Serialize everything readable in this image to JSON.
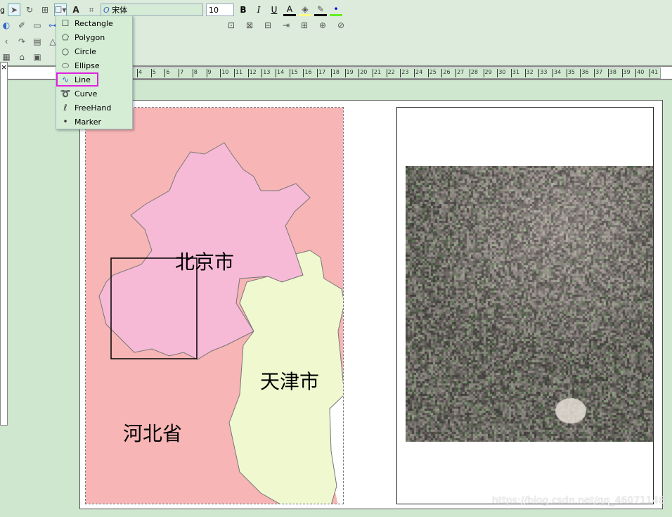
{
  "toolbar": {
    "font_name": "宋体",
    "font_size": "10",
    "bold": "B",
    "italic": "I",
    "underline": "U",
    "text_tool": "A",
    "left_fragment": "g"
  },
  "draw_menu": {
    "items": [
      {
        "label": "Rectangle",
        "icon": "rectangle-icon",
        "glyph": "☐"
      },
      {
        "label": "Polygon",
        "icon": "polygon-icon",
        "glyph": "⬠"
      },
      {
        "label": "Circle",
        "icon": "circle-icon",
        "glyph": "○"
      },
      {
        "label": "Ellipse",
        "icon": "ellipse-icon",
        "glyph": "⬭"
      },
      {
        "label": "Line",
        "icon": "line-icon",
        "glyph": "∿",
        "highlighted": true
      },
      {
        "label": "Curve",
        "icon": "curve-icon",
        "glyph": "➰"
      },
      {
        "label": "FreeHand",
        "icon": "freehand-icon",
        "glyph": "ℓ"
      },
      {
        "label": "Marker",
        "icon": "marker-icon",
        "glyph": "•"
      }
    ]
  },
  "ruler": {
    "labels": [
      "4",
      "5",
      "6",
      "7",
      "8",
      "9",
      "10",
      "11",
      "12",
      "13",
      "14",
      "15",
      "16",
      "17",
      "18",
      "19",
      "20",
      "21",
      "22",
      "23",
      "24",
      "25",
      "26",
      "27",
      "28",
      "29",
      "30",
      "31",
      "32",
      "33",
      "34",
      "35",
      "36",
      "37",
      "38",
      "39",
      "40",
      "41"
    ]
  },
  "panel": {
    "close": "×"
  },
  "map": {
    "beijing": "北京市",
    "tianjin": "天津市",
    "hebei": "河北省",
    "colors": {
      "hebei": "#f7b5b5",
      "beijing": "#f7bad6",
      "tianjin": "#f0f8d0",
      "highlight": "#e020e0"
    }
  },
  "watermark": "https://blog.csdn.net/qq_46071146"
}
